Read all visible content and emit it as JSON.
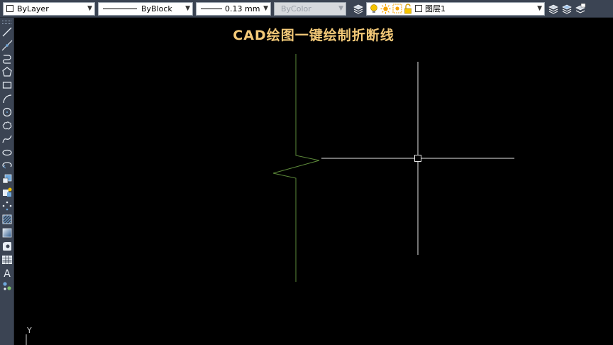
{
  "toolbar": {
    "color": {
      "value": "ByLayer"
    },
    "linetype": {
      "value": "ByBlock"
    },
    "lineweight": {
      "value": "0.13 mm"
    },
    "plotstyle": {
      "value": "ByColor"
    },
    "layer": {
      "value": "图层1"
    }
  },
  "caption": "CAD绘图一键绘制折断线",
  "ucs_axis": "Y",
  "colors": {
    "toolbar_bg": "#3b4453",
    "canvas_bg": "#000000",
    "caption_text": "#f3c978",
    "breakline": "#5d8a3a",
    "crosshair": "#e6e6e6"
  },
  "icons": {
    "top": [
      "layer-manager-icon",
      "lightbulb-on-icon",
      "sun-freeze-icon",
      "lock-open-icon",
      "color-square-icon",
      "layer-previous-icon",
      "layer-states-icon",
      "layer-isolate-icon"
    ],
    "left": [
      "line-icon",
      "construction-line-icon",
      "polyline-icon",
      "polygon-icon",
      "rectangle-icon",
      "arc-icon",
      "circle-icon",
      "revision-cloud-icon",
      "spline-icon",
      "ellipse-icon",
      "ellipse-arc-icon",
      "insert-block-icon",
      "make-block-icon",
      "point-icon",
      "hatch-icon",
      "gradient-icon",
      "region-icon",
      "table-icon",
      "multiline-text-icon",
      "add-selected-icon"
    ]
  }
}
